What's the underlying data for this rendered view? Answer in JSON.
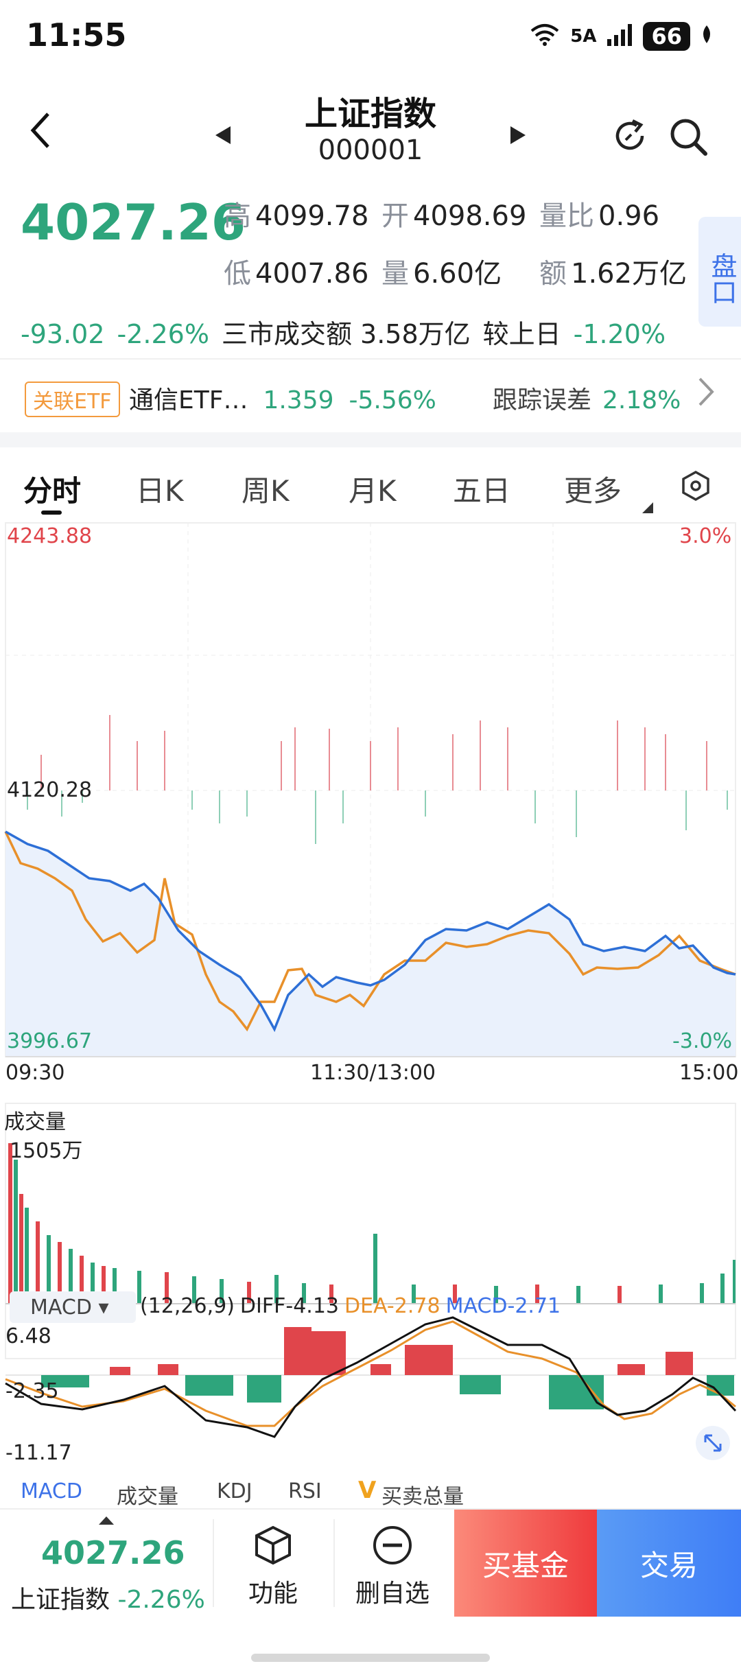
{
  "status": {
    "time": "11:55",
    "network": "5A",
    "battery": "66"
  },
  "header": {
    "title": "上证指数",
    "code": "000001"
  },
  "quote": {
    "price": "4027.26",
    "high_label": "高",
    "high": "4099.78",
    "open_label": "开",
    "open": "4098.69",
    "ratio_label": "量比",
    "ratio": "0.96",
    "low_label": "低",
    "low": "4007.86",
    "vol_label": "量",
    "vol": "6.60亿",
    "amt_label": "额",
    "amt": "1.62万亿",
    "change": "-93.02",
    "change_pct": "-2.26%",
    "market_turnover": "三市成交额 3.58万亿",
    "vs_prev_label": "较上日",
    "vs_prev": "-1.20%",
    "pankou": "盘口"
  },
  "etf": {
    "badge": "关联ETF",
    "name": "通信ETF…",
    "price": "1.359",
    "pct": "-5.56%",
    "tracking_label": "跟踪误差",
    "tracking": "2.18%"
  },
  "tabs": [
    "分时",
    "日K",
    "周K",
    "月K",
    "五日",
    "更多"
  ],
  "chart": {
    "price_top": "4243.88",
    "price_mid": "4120.28",
    "price_bottom": "3996.67",
    "pct_top": "3.0%",
    "pct_bottom": "-3.0%",
    "time_start": "09:30",
    "time_mid": "11:30/13:00",
    "time_end": "15:00",
    "volume_title": "成交量",
    "volume_max": "1505万",
    "macd_selector": "MACD",
    "macd_params": "(12,26,9)",
    "diff": "DIFF-4.13",
    "dea": "DEA-2.78",
    "macd": "MACD-2.71",
    "macd_top": "6.48",
    "macd_mid": "-2.35",
    "macd_bottom": "-11.17"
  },
  "indicator_tabs": [
    "MACD",
    "成交量",
    "KDJ",
    "RSI",
    "买卖总量"
  ],
  "bottom": {
    "price": "4027.26",
    "name": "上证指数",
    "pct": "-2.26%",
    "func": "功能",
    "remove": "删自选",
    "buy_fund": "买基金",
    "trade": "交易"
  },
  "chart_data": {
    "type": "line",
    "x": [
      "09:30",
      "11:30/13:00",
      "15:00"
    ],
    "ylim": [
      3996.67,
      4243.88
    ],
    "series": []
  }
}
